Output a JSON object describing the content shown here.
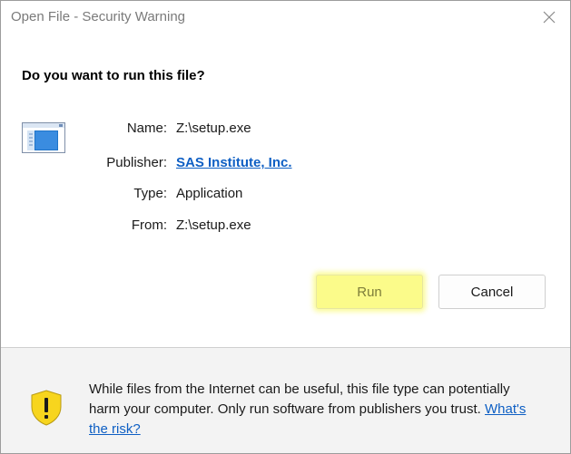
{
  "window": {
    "title": "Open File - Security Warning",
    "close_icon": "close-icon"
  },
  "question": "Do you want to run this file?",
  "file_icon": "application-file-icon",
  "details": {
    "name_label": "Name:",
    "name_value": "Z:\\setup.exe",
    "publisher_label": "Publisher:",
    "publisher_value": "SAS Institute, Inc.",
    "type_label": "Type:",
    "type_value": "Application",
    "from_label": "From:",
    "from_value": "Z:\\setup.exe"
  },
  "buttons": {
    "run_label": "Run",
    "cancel_label": "Cancel"
  },
  "footer": {
    "shield_icon": "warning-shield-icon",
    "warning_text": "While files from the Internet can be useful, this file type can potentially harm your computer. Only run software from publishers you trust. ",
    "risk_link": "What's the risk?"
  },
  "colors": {
    "link": "#0e5fc4",
    "run_highlight": "#fbfb8a",
    "shield_yellow": "#f7d51e",
    "footer_bg": "#f3f3f3"
  }
}
